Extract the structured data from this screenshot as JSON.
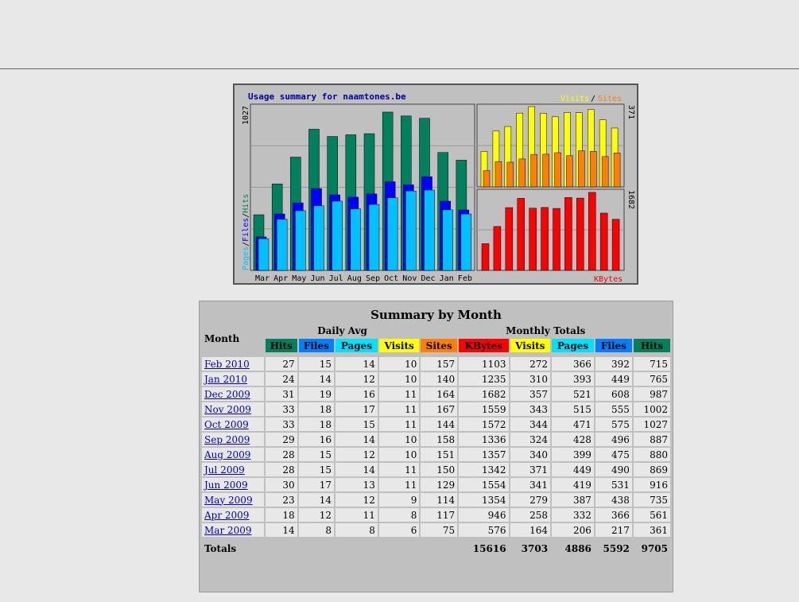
{
  "graph": {
    "title": "Usage summary for naamtones.be",
    "right_legend": {
      "visits": "Visits",
      "sep": "/",
      "sites": "Sites"
    },
    "left_legend": {
      "pages": "Pages",
      "sep": "/",
      "files": "Files",
      "hits": "Hits"
    },
    "left_max": "1027",
    "right_top_max": "371",
    "right_bottom_max": "1682",
    "kbytes_label": "KBytes",
    "colors": {
      "hits": "#00805c",
      "files": "#0000ff",
      "pages": "#00c0ff",
      "visits": "#ffff00",
      "sites": "#ff8000",
      "kbytes": "#ff0000"
    }
  },
  "chart_data": {
    "type": "bar",
    "categories": [
      "Mar",
      "Apr",
      "May",
      "Jun",
      "Jul",
      "Aug",
      "Sep",
      "Oct",
      "Nov",
      "Dec",
      "Jan",
      "Feb"
    ],
    "series": [
      {
        "name": "Hits",
        "values": [
          361,
          561,
          735,
          916,
          869,
          880,
          887,
          1027,
          1002,
          987,
          765,
          715
        ]
      },
      {
        "name": "Files",
        "values": [
          217,
          366,
          438,
          531,
          490,
          475,
          496,
          575,
          555,
          608,
          449,
          392
        ]
      },
      {
        "name": "Pages",
        "values": [
          206,
          332,
          387,
          419,
          449,
          399,
          428,
          471,
          515,
          521,
          393,
          366
        ]
      },
      {
        "name": "Visits",
        "values": [
          164,
          258,
          279,
          341,
          371,
          340,
          324,
          344,
          343,
          357,
          310,
          272
        ]
      },
      {
        "name": "Sites",
        "values": [
          75,
          117,
          114,
          129,
          150,
          151,
          158,
          144,
          167,
          164,
          140,
          157
        ]
      },
      {
        "name": "KBytes",
        "values": [
          576,
          946,
          1354,
          1554,
          1342,
          1357,
          1336,
          1572,
          1559,
          1682,
          1235,
          1103
        ]
      }
    ]
  },
  "table": {
    "caption": "Summary by Month",
    "month_header": "Month",
    "daily_avg": "Daily Avg",
    "monthly_totals": "Monthly Totals",
    "daily_cols": [
      {
        "label": "Hits",
        "color": "#00805c",
        "text": "#000"
      },
      {
        "label": "Files",
        "color": "#0080ff",
        "text": "#000"
      },
      {
        "label": "Pages",
        "color": "#00e0ff",
        "text": "#000"
      },
      {
        "label": "Visits",
        "color": "#ffff00",
        "text": "#000"
      }
    ],
    "monthly_cols": [
      {
        "label": "Sites",
        "color": "#ff8000",
        "text": "#000"
      },
      {
        "label": "KBytes",
        "color": "#ff0000",
        "text": "#000"
      },
      {
        "label": "Visits",
        "color": "#ffff00",
        "text": "#000"
      },
      {
        "label": "Pages",
        "color": "#00e0ff",
        "text": "#000"
      },
      {
        "label": "Files",
        "color": "#0080ff",
        "text": "#000"
      },
      {
        "label": "Hits",
        "color": "#00805c",
        "text": "#000"
      }
    ],
    "rows": [
      {
        "month": "Feb 2010",
        "v": [
          "27",
          "15",
          "14",
          "10",
          "157",
          "1103",
          "272",
          "366",
          "392",
          "715"
        ]
      },
      {
        "month": "Jan 2010",
        "v": [
          "24",
          "14",
          "12",
          "10",
          "140",
          "1235",
          "310",
          "393",
          "449",
          "765"
        ]
      },
      {
        "month": "Dec 2009",
        "v": [
          "31",
          "19",
          "16",
          "11",
          "164",
          "1682",
          "357",
          "521",
          "608",
          "987"
        ]
      },
      {
        "month": "Nov 2009",
        "v": [
          "33",
          "18",
          "17",
          "11",
          "167",
          "1559",
          "343",
          "515",
          "555",
          "1002"
        ]
      },
      {
        "month": "Oct 2009",
        "v": [
          "33",
          "18",
          "15",
          "11",
          "144",
          "1572",
          "344",
          "471",
          "575",
          "1027"
        ]
      },
      {
        "month": "Sep 2009",
        "v": [
          "29",
          "16",
          "14",
          "10",
          "158",
          "1336",
          "324",
          "428",
          "496",
          "887"
        ]
      },
      {
        "month": "Aug 2009",
        "v": [
          "28",
          "15",
          "12",
          "10",
          "151",
          "1357",
          "340",
          "399",
          "475",
          "880"
        ]
      },
      {
        "month": "Jul 2009",
        "v": [
          "28",
          "15",
          "14",
          "11",
          "150",
          "1342",
          "371",
          "449",
          "490",
          "869"
        ]
      },
      {
        "month": "Jun 2009",
        "v": [
          "30",
          "17",
          "13",
          "11",
          "129",
          "1554",
          "341",
          "419",
          "531",
          "916"
        ]
      },
      {
        "month": "May 2009",
        "v": [
          "23",
          "14",
          "12",
          "9",
          "114",
          "1354",
          "279",
          "387",
          "438",
          "735"
        ]
      },
      {
        "month": "Apr 2009",
        "v": [
          "18",
          "12",
          "11",
          "8",
          "117",
          "946",
          "258",
          "332",
          "366",
          "561"
        ]
      },
      {
        "month": "Mar 2009",
        "v": [
          "14",
          "8",
          "8",
          "6",
          "75",
          "576",
          "164",
          "206",
          "217",
          "361"
        ]
      }
    ],
    "totals_label": "Totals",
    "totals": [
      "15616",
      "3703",
      "4886",
      "5592",
      "9705"
    ]
  }
}
